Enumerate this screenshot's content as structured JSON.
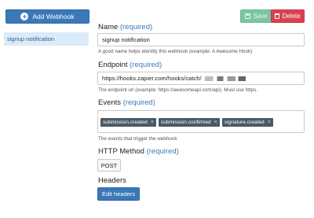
{
  "sidebar": {
    "add_button_label": "Add Webhook",
    "items": [
      {
        "label": "signup notification",
        "selected": true
      }
    ]
  },
  "toolbar": {
    "save_label": "Save",
    "delete_label": "Delete"
  },
  "form": {
    "name": {
      "label": "Name",
      "required": "(required)",
      "value": "signup notification",
      "help": "A good name helps identify this webhook (example: A Awesome Hook)"
    },
    "endpoint": {
      "label": "Endpoint",
      "required": "(required)",
      "value": "https://hooks.zapier.com/hooks/catch/",
      "help": "The endpoint url (example: https://awesomeapi.com/api). Must use https."
    },
    "events": {
      "label": "Events",
      "required": "(required)",
      "tags": [
        "submission.created",
        "submission.confirmed",
        "signature.created"
      ],
      "help": "The events that trigger the webhook"
    },
    "method": {
      "label": "HTTP Method",
      "required": "(required)",
      "value": "POST"
    },
    "headers": {
      "label": "Headers",
      "button_label": "Edit headers"
    }
  },
  "colors": {
    "primary": "#3a78b8",
    "save": "#7cc4a4",
    "delete": "#d9434e",
    "tag": "#4a5966",
    "selected_bg": "#dcebf8"
  }
}
